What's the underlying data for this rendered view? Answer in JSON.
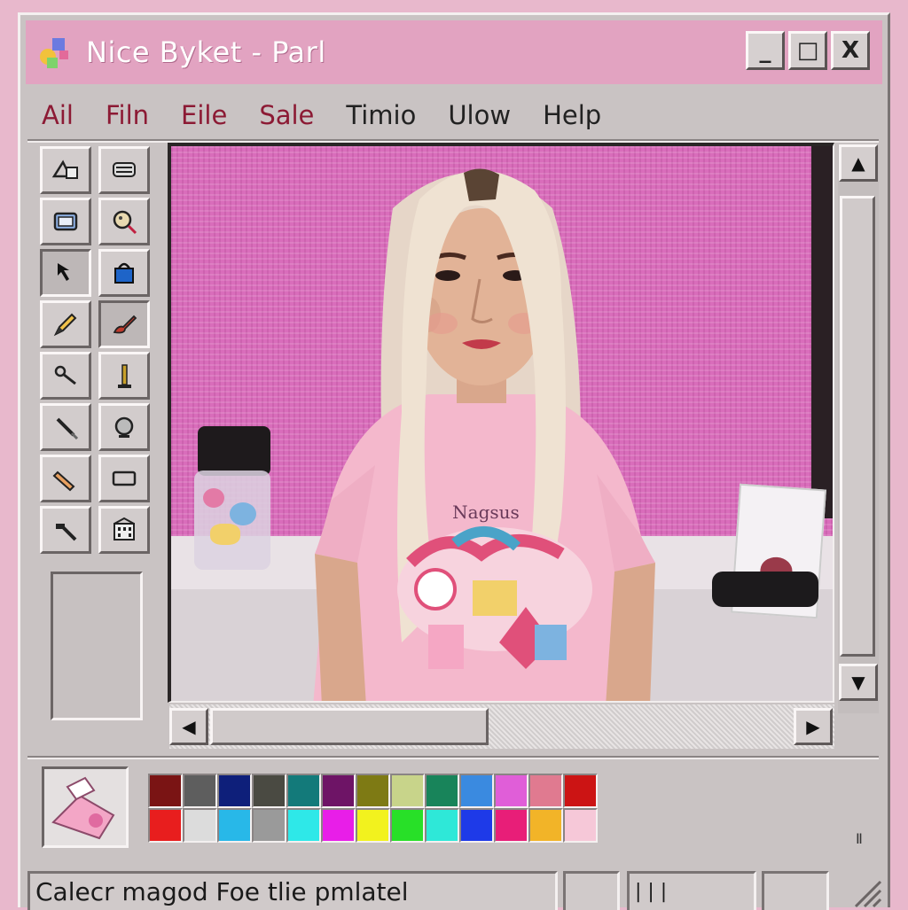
{
  "window": {
    "title": "Nice Byket - Parl",
    "controls": {
      "minimize": "_",
      "maximize": "□",
      "close": "X"
    }
  },
  "menu": {
    "items": [
      {
        "label": "Ail",
        "color": "#8c1a34"
      },
      {
        "label": "Filn",
        "color": "#8c1a34"
      },
      {
        "label": "Eile",
        "color": "#8c1a34"
      },
      {
        "label": "Sale",
        "color": "#8c1a34"
      },
      {
        "label": "Timio",
        "color": "#222222"
      },
      {
        "label": "Ulow",
        "color": "#222222"
      },
      {
        "label": "Help",
        "color": "#222222"
      }
    ]
  },
  "toolbox": {
    "tools": [
      "select-icon",
      "stamp-icon",
      "frame-icon",
      "magnifier-icon",
      "arrow-cursor-icon",
      "bucket-icon",
      "pencil-icon",
      "brush-icon",
      "eyedropper-icon",
      "line-icon",
      "pen-icon",
      "circle-icon",
      "eraser-icon",
      "rectangle-icon",
      "hammer-icon",
      "building-icon"
    ],
    "active_tool": "arrow-cursor-icon"
  },
  "canvas": {
    "shirt_text": "Nagsus"
  },
  "palette": {
    "colors": [
      "#7a1414",
      "#5e5e5e",
      "#0e1f7a",
      "#4a4a42",
      "#137a7a",
      "#6e1466",
      "#7e7a14",
      "#c8d48a",
      "#18845a",
      "#3a8ae0",
      "#e05ed8",
      "#e07a90",
      "#cc1414",
      "#e81e1e",
      "#dcdcdc",
      "#28b8e8",
      "#9a9a9a",
      "#2ee8e8",
      "#e81ee8",
      "#f2f21e",
      "#28e028",
      "#2ee8d8",
      "#1e3ae8",
      "#e81e78",
      "#f2b428",
      "#f6c8d8"
    ]
  },
  "scrollbars": {
    "up": "▲",
    "down": "▼",
    "left": "◀",
    "right": "▶"
  },
  "status": {
    "text": "Calecr magod Foe tlie pmlatel",
    "corner_mark": "Ⅱ",
    "field3": "| | |"
  },
  "theme": {
    "titlebar": "#e2a3c1",
    "window_face": "#c9c3c3",
    "desktop": "#e8b8cc"
  }
}
